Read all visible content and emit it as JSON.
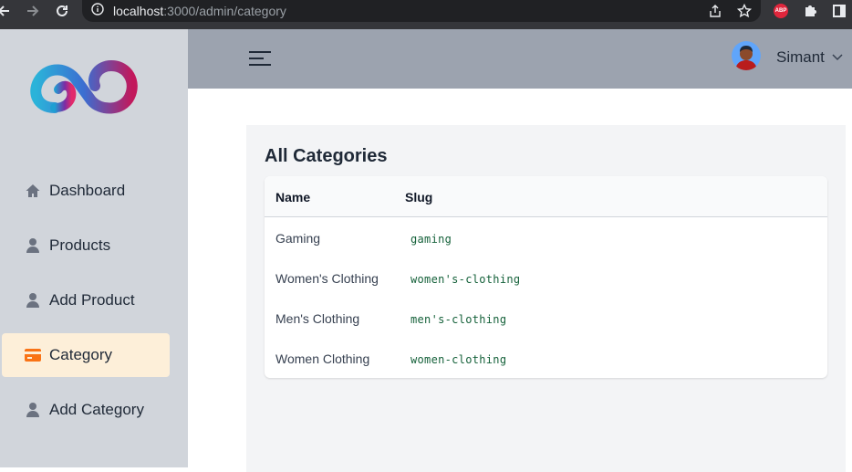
{
  "browser": {
    "url_host": "localhost",
    "url_rest": ":3000/admin/category",
    "extension_abp": "ABP"
  },
  "sidebar": {
    "items": [
      {
        "label": "Dashboard",
        "icon": "home-icon"
      },
      {
        "label": "Products",
        "icon": "user-icon"
      },
      {
        "label": "Add Product",
        "icon": "user-icon"
      },
      {
        "label": "Category",
        "icon": "credit-card-icon",
        "active": true
      },
      {
        "label": "Add Category",
        "icon": "user-icon"
      }
    ]
  },
  "header": {
    "user_name": "Simant"
  },
  "main": {
    "title": "All Categories",
    "table": {
      "columns": [
        "Name",
        "Slug"
      ],
      "rows": [
        {
          "name": "Gaming",
          "slug": "gaming"
        },
        {
          "name": "Women's Clothing",
          "slug": "women's-clothing"
        },
        {
          "name": "Men's Clothing",
          "slug": "men's-clothing"
        },
        {
          "name": "Women Clothing",
          "slug": "women-clothing"
        }
      ]
    }
  },
  "colors": {
    "sidebar_bg": "#d1d5db",
    "topbar_bg": "#9ca3af",
    "active_item_bg": "#fdefd9",
    "active_icon": "#f97316",
    "slug_text": "#15613a"
  }
}
